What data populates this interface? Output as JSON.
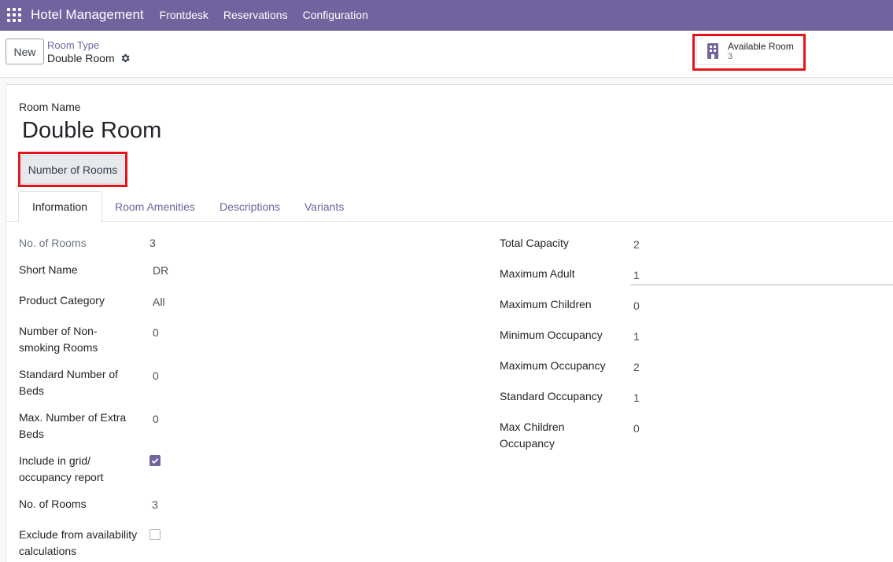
{
  "nav": {
    "brand": "Hotel Management",
    "menu": [
      "Frontdesk",
      "Reservations",
      "Configuration"
    ]
  },
  "control": {
    "new_label": "New",
    "breadcrumb": "Room Type",
    "current": "Double Room",
    "stat": {
      "label": "Available Room",
      "value": "3"
    }
  },
  "form": {
    "room_name_label": "Room Name",
    "room_name": "Double Room",
    "rooms_button": "Number of Rooms",
    "tabs": [
      "Information",
      "Room Amenities",
      "Descriptions",
      "Variants"
    ],
    "left_fields": [
      {
        "label": "No. of Rooms",
        "value": "3"
      },
      {
        "label": "Short Name",
        "value": "DR"
      },
      {
        "label": "Product Category",
        "value": "All"
      },
      {
        "label": "Number of Non-smoking Rooms",
        "label_lines": [
          "Number of Non-",
          "smoking Rooms"
        ],
        "value": "0"
      },
      {
        "label": "Standard Number of Beds",
        "label_lines": [
          "Standard Number of",
          "Beds"
        ],
        "value": "0"
      },
      {
        "label": "Max. Number of Extra Beds",
        "label_lines": [
          "Max. Number of Extra",
          "Beds"
        ],
        "value": "0"
      },
      {
        "label": "Include in grid/ occupancy report",
        "label_lines": [
          "Include in grid/",
          "occupancy report"
        ],
        "checked": true
      },
      {
        "label": "No. of Rooms",
        "value": "3"
      },
      {
        "label": "Exclude from availability calculations",
        "label_lines": [
          "Exclude from availability",
          "calculations"
        ],
        "checked": false
      }
    ],
    "right_fields": [
      {
        "label": "Total Capacity",
        "value": "2"
      },
      {
        "label": "Maximum Adult",
        "value": "1"
      },
      {
        "label": "Maximum Children",
        "value": "0"
      },
      {
        "label": "Minimum Occupancy",
        "value": "1"
      },
      {
        "label": "Maximum Occupancy",
        "value": "2"
      },
      {
        "label": "Standard Occupancy",
        "value": "1"
      },
      {
        "label": "Max Children Occupancy",
        "label_lines": [
          "Max Children",
          "Occupancy"
        ],
        "value": "0"
      }
    ]
  },
  "colors": {
    "brand": "#71639e",
    "highlight": "#e8131a"
  }
}
